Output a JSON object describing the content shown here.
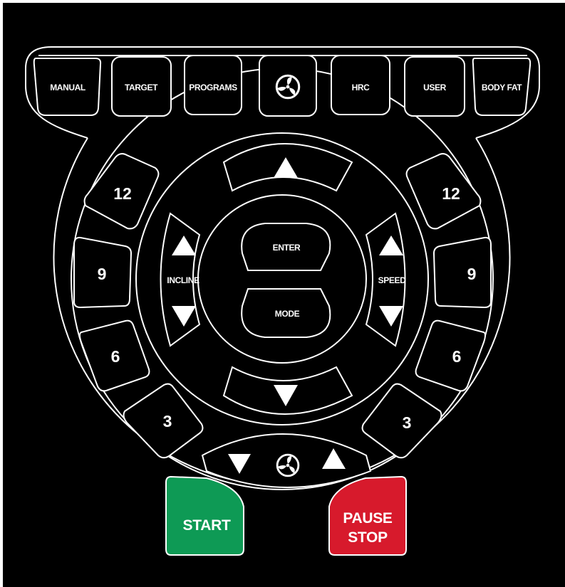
{
  "top_keys": [
    "MANUAL",
    "TARGET",
    "PROGRAMS",
    "fan-icon",
    "HRC",
    "USER",
    "BODY FAT"
  ],
  "incline_presets": [
    "12",
    "9",
    "6",
    "3"
  ],
  "speed_presets": [
    "12",
    "9",
    "6",
    "3"
  ],
  "center": {
    "enter_label": "ENTER",
    "mode_label": "MODE",
    "incline_label": "INCLINE",
    "speed_label": "SPEED"
  },
  "fan_control": {
    "down_icon": "triangle-down-icon",
    "fan_icon": "fan-icon",
    "up_icon": "triangle-up-icon"
  },
  "start_label": "START",
  "stop_label_line1": "PAUSE",
  "stop_label_line2": "STOP",
  "colors": {
    "background": "#000000",
    "outline": "#ffffff",
    "start": "#0e9a55",
    "stop": "#d71a2c"
  }
}
